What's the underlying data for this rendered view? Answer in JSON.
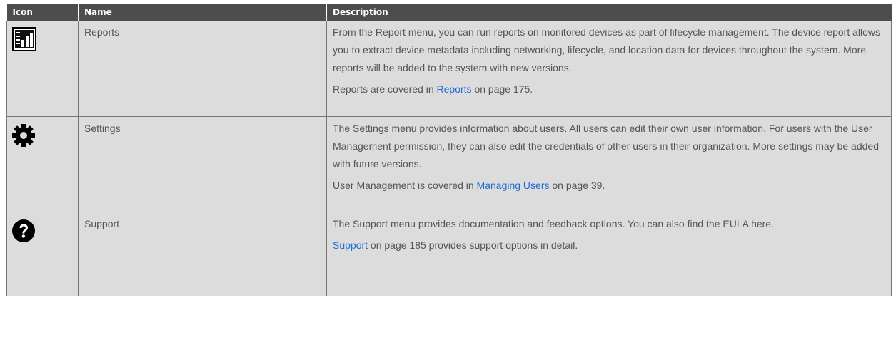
{
  "table": {
    "headers": {
      "icon": "Icon",
      "name": "Name",
      "description": "Description"
    },
    "rows": [
      {
        "icon": "reports-chart-icon",
        "name": "Reports",
        "description": "From the Report menu, you can run reports on monitored devices as part of lifecycle management. The device report allows you to extract device metadata including networking, lifecycle, and location data for devices throughout the system. More reports will be added to the system with new versions.",
        "ref_prefix": "Reports are covered in ",
        "ref_link": "Reports",
        "ref_suffix": " on page 175."
      },
      {
        "icon": "gear-icon",
        "name": "Settings",
        "description": "The Settings menu provides information about users. All users can edit their own user information. For users with the User Management permission, they can also edit the credentials of other users in their organization. More settings may be added with future versions.",
        "ref_prefix": "User Management is covered in ",
        "ref_link": "Managing Users",
        "ref_suffix": " on page 39."
      },
      {
        "icon": "question-circle-icon",
        "name": "Support",
        "description": "The Support menu provides documentation and feedback options. You can also find the EULA here.",
        "ref_prefix": "",
        "ref_link": "Support",
        "ref_suffix": " on page 185 provides support options in detail."
      }
    ]
  }
}
